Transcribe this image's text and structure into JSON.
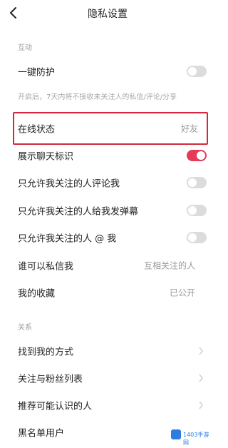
{
  "header": {
    "title": "隐私设置",
    "back_icon": "back-arrow-icon"
  },
  "sections": {
    "interaction_label": "互动",
    "relationship_label": "关系"
  },
  "rows": {
    "protection": {
      "label": "一键防护",
      "toggle_on": false
    },
    "protection_note": "开启后，7天内将不接收未关注人的私信/评论/分享",
    "online_status": {
      "label": "在线状态",
      "value": "好友"
    },
    "chat_badge": {
      "label": "展示聊天标识",
      "toggle_on": true
    },
    "comment_only": {
      "label": "只允许我关注的人评论我",
      "toggle_on": false
    },
    "danmu_only": {
      "label": "只允许我关注的人给我发弹幕",
      "toggle_on": false
    },
    "mention_only": {
      "label": "只允许我关注的人 @ 我",
      "toggle_on": false
    },
    "who_can_dm": {
      "label": "谁可以私信我",
      "value": "互相关注的人"
    },
    "my_favorites": {
      "label": "我的收藏",
      "value": "已公开"
    },
    "find_me": {
      "label": "找到我的方式"
    },
    "follow_list": {
      "label": "关注与粉丝列表"
    },
    "recommend": {
      "label": "推荐可能认识的人"
    },
    "blacklist": {
      "label": "黑名单用户"
    }
  },
  "colors": {
    "toggle_on": "#e53a58",
    "toggle_off": "#dcdcdc",
    "highlight": "#d4283c"
  },
  "watermark": {
    "text": "1403手游网"
  }
}
